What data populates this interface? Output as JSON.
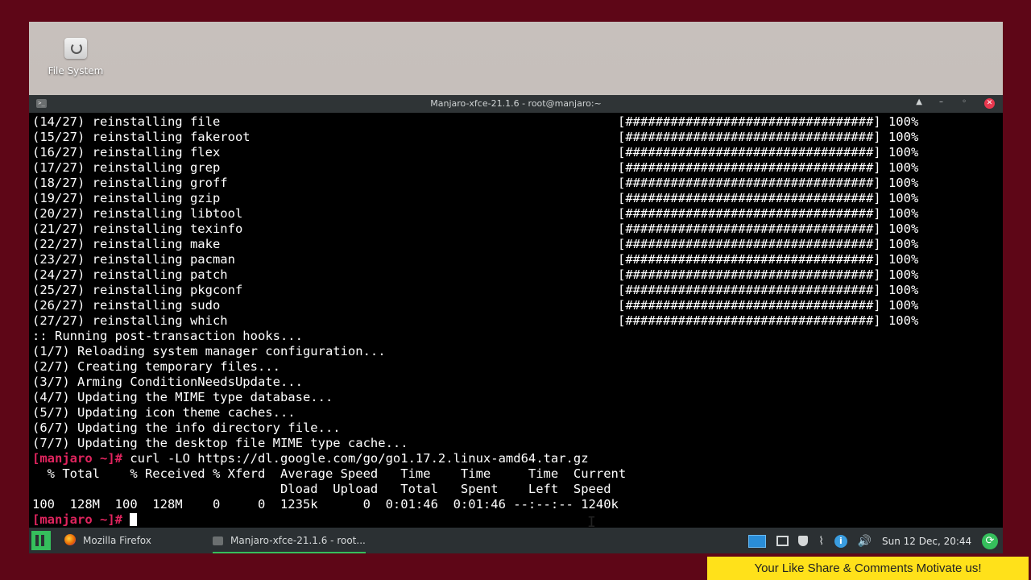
{
  "desktop": {
    "icon_label": "File System"
  },
  "window": {
    "title": "Manjaro-xfce-21.1.6 - root@manjaro:~",
    "controls": {
      "up": "▲",
      "minimize": "–",
      "maximize": "◦",
      "close": "✕"
    }
  },
  "terminal": {
    "progress_bar": "[#################################]",
    "reinstall_lines": [
      {
        "text": "(14/27) reinstalling file",
        "percent": "100%"
      },
      {
        "text": "(15/27) reinstalling fakeroot",
        "percent": "100%"
      },
      {
        "text": "(16/27) reinstalling flex",
        "percent": "100%"
      },
      {
        "text": "(17/27) reinstalling grep",
        "percent": "100%"
      },
      {
        "text": "(18/27) reinstalling groff",
        "percent": "100%"
      },
      {
        "text": "(19/27) reinstalling gzip",
        "percent": "100%"
      },
      {
        "text": "(20/27) reinstalling libtool",
        "percent": "100%"
      },
      {
        "text": "(21/27) reinstalling texinfo",
        "percent": "100%"
      },
      {
        "text": "(22/27) reinstalling make",
        "percent": "100%"
      },
      {
        "text": "(23/27) reinstalling pacman",
        "percent": "100%"
      },
      {
        "text": "(24/27) reinstalling patch",
        "percent": "100%"
      },
      {
        "text": "(25/27) reinstalling pkgconf",
        "percent": "100%"
      },
      {
        "text": "(26/27) reinstalling sudo",
        "percent": "100%"
      },
      {
        "text": "(27/27) reinstalling which",
        "percent": "100%"
      }
    ],
    "hook_lines": [
      ":: Running post-transaction hooks...",
      "(1/7) Reloading system manager configuration...",
      "(2/7) Creating temporary files...",
      "(3/7) Arming ConditionNeedsUpdate...",
      "(4/7) Updating the MIME type database...",
      "(5/7) Updating icon theme caches...",
      "(6/7) Updating the info directory file...",
      "(7/7) Updating the desktop file MIME type cache..."
    ],
    "prompt": "[manjaro ~]#",
    "command": " curl -LO https://dl.google.com/go/go1.17.2.linux-amd64.tar.gz",
    "curl_header_1": "  % Total    % Received % Xferd  Average Speed   Time    Time     Time  Current",
    "curl_header_2": "                                 Dload  Upload   Total   Spent    Left  Speed",
    "curl_stats": "100  128M  100  128M    0     0  1235k      0  0:01:46  0:01:46 --:--:-- 1240k"
  },
  "taskbar": {
    "firefox_label": "Mozilla Firefox",
    "terminal_label": "Manjaro-xfce-21.1.6 - root...",
    "clock": "Sun 12 Dec, 20:44",
    "info_glyph": "i",
    "clip_glyph": "⌇",
    "volume_glyph": "🔊",
    "update_glyph": "⟳"
  },
  "banner": {
    "text": "Your Like Share & Comments Motivate us!"
  },
  "colors": {
    "frame_background": "#5e0617",
    "prompt": "#e0245e",
    "manjaro_green": "#35bf5c",
    "banner": "#ffe11a"
  }
}
